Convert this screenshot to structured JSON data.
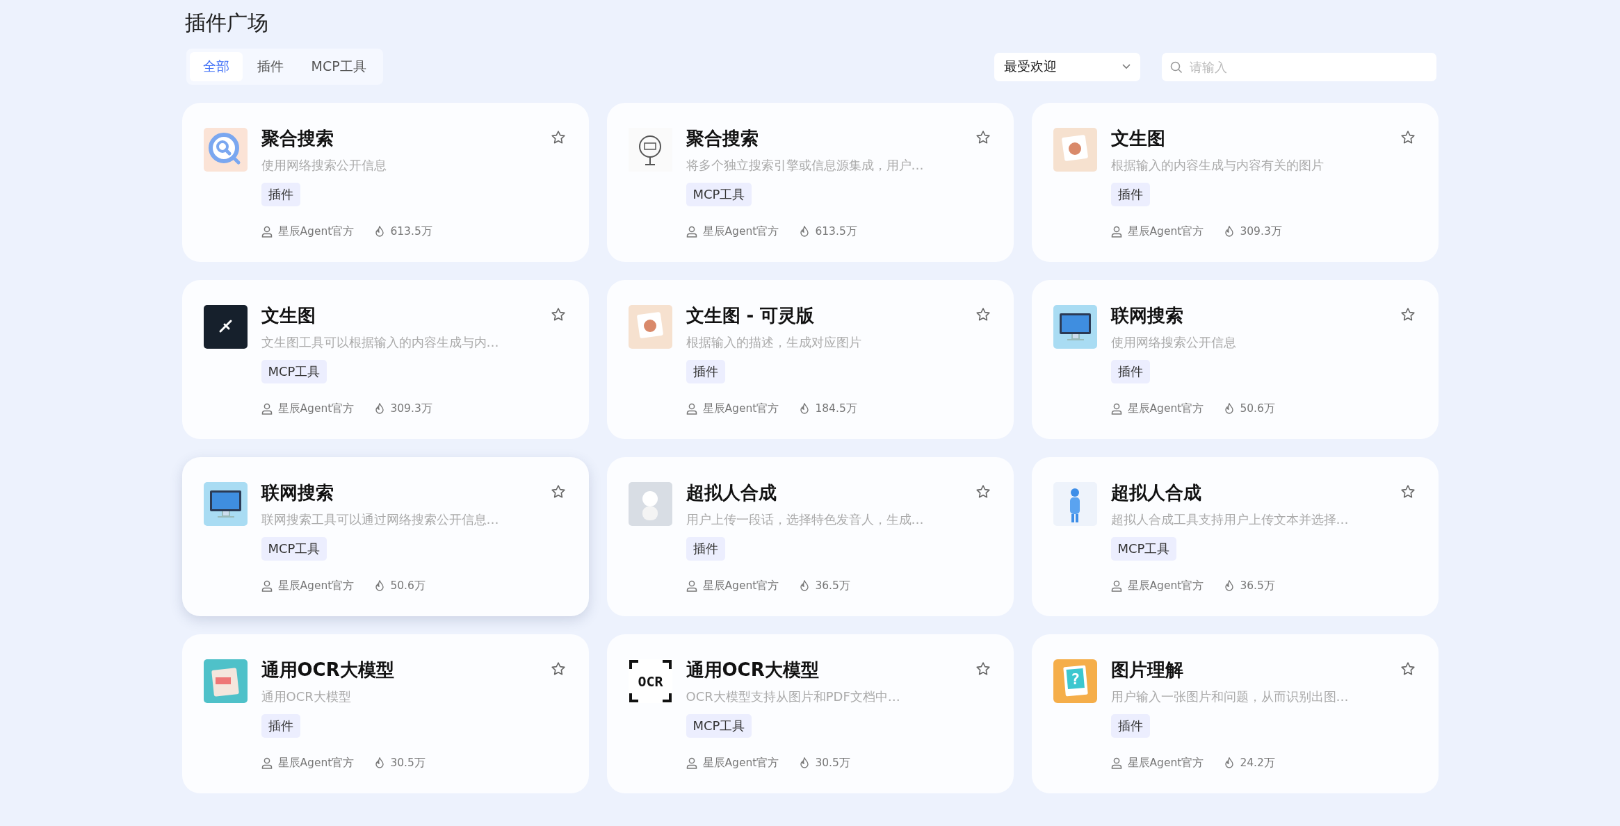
{
  "page_title": "插件广场",
  "tabs": [
    {
      "label": "全部",
      "selected": true
    },
    {
      "label": "插件",
      "selected": false
    },
    {
      "label": "MCP工具",
      "selected": false
    }
  ],
  "sort": {
    "value": "最受欢迎"
  },
  "search": {
    "placeholder": "请输入"
  },
  "cards": [
    {
      "title": "聚合搜索",
      "description": "使用网络搜索公开信息",
      "tag": "插件",
      "author": "星辰Agent官方",
      "count": "613.5万",
      "kind": "magnifier",
      "favorited": false,
      "hovered": false
    },
    {
      "title": "聚合搜索",
      "description": "将多个独立搜索引擎或信息源集成，用户…",
      "tag": "MCP工具",
      "author": "星辰Agent官方",
      "count": "613.5万",
      "kind": "sketch",
      "favorited": false,
      "hovered": false
    },
    {
      "title": "文生图",
      "description": "根据输入的内容生成与内容有关的图片",
      "tag": "插件",
      "author": "星辰Agent官方",
      "count": "309.3万",
      "kind": "warm",
      "favorited": false,
      "hovered": false
    },
    {
      "title": "文生图",
      "description": "文生图工具可以根据输入的内容生成与内…",
      "tag": "MCP工具",
      "author": "星辰Agent官方",
      "count": "309.3万",
      "kind": "dark",
      "favorited": false,
      "hovered": false
    },
    {
      "title": "文生图 - 可灵版",
      "description": "根据输入的描述，生成对应图片",
      "tag": "插件",
      "author": "星辰Agent官方",
      "count": "184.5万",
      "kind": "warm",
      "favorited": false,
      "hovered": false
    },
    {
      "title": "联网搜索",
      "description": "使用网络搜索公开信息",
      "tag": "插件",
      "author": "星辰Agent官方",
      "count": "50.6万",
      "kind": "monitor",
      "favorited": false,
      "hovered": false
    },
    {
      "title": "联网搜索",
      "description": "联网搜索工具可以通过网络搜索公开信息…",
      "tag": "MCP工具",
      "author": "星辰Agent官方",
      "count": "50.6万",
      "kind": "monitor",
      "favorited": false,
      "hovered": true
    },
    {
      "title": "超拟人合成",
      "description": "用户上传一段话，选择特色发音人，生成…",
      "tag": "插件",
      "author": "星辰Agent官方",
      "count": "36.5万",
      "kind": "figure",
      "favorited": false,
      "hovered": false
    },
    {
      "title": "超拟人合成",
      "description": "超拟人合成工具支持用户上传文本并选择…",
      "tag": "MCP工具",
      "author": "星辰Agent官方",
      "count": "36.5万",
      "kind": "bluebody",
      "favorited": false,
      "hovered": false
    },
    {
      "title": "通用OCR大模型",
      "description": "通用OCR大模型",
      "tag": "插件",
      "author": "星辰Agent官方",
      "count": "30.5万",
      "kind": "teal",
      "favorited": false,
      "hovered": false
    },
    {
      "title": "通用OCR大模型",
      "description": "OCR大模型支持从图片和PDF文档中…",
      "tag": "MCP工具",
      "author": "星辰Agent官方",
      "count": "30.5万",
      "kind": "ocr",
      "thumb_text": "OCR",
      "favorited": false,
      "hovered": false
    },
    {
      "title": "图片理解",
      "description": "用户输入一张图片和问题，从而识别出图…",
      "tag": "插件",
      "author": "星辰Agent官方",
      "count": "24.2万",
      "kind": "question",
      "thumb_text": "?",
      "favorited": false,
      "hovered": false
    }
  ]
}
